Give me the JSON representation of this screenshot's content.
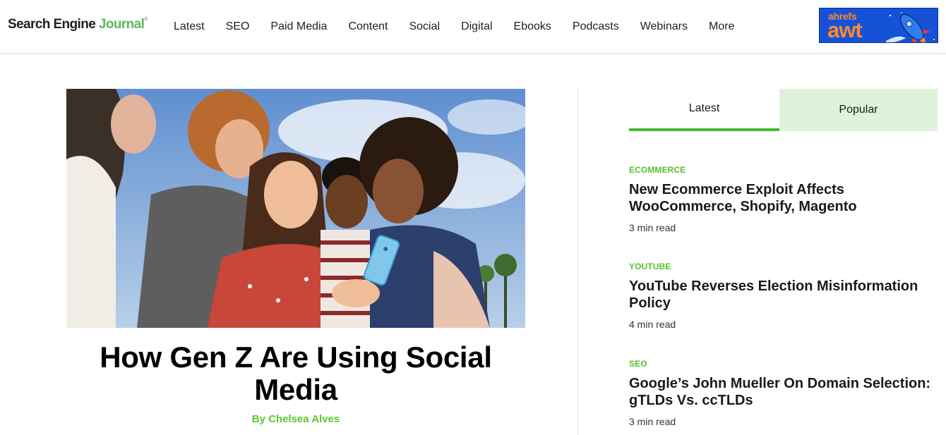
{
  "logo": {
    "text_main": "Search Engine ",
    "text_accent": "Journal",
    "tm": "®"
  },
  "nav": [
    {
      "label": "Latest"
    },
    {
      "label": "SEO"
    },
    {
      "label": "Paid Media"
    },
    {
      "label": "Content"
    },
    {
      "label": "Social"
    },
    {
      "label": "Digital"
    },
    {
      "label": "Ebooks"
    },
    {
      "label": "Podcasts"
    },
    {
      "label": "Webinars"
    },
    {
      "label": "More"
    }
  ],
  "ad": {
    "brand": "ahrefs",
    "product": "awt"
  },
  "hero": {
    "image_icon": "group-photo",
    "title": "How Gen Z Are Using Social Media",
    "byline": "By Chelsea Alves"
  },
  "sidebar": {
    "tabs": [
      {
        "label": "Latest"
      },
      {
        "label": "Popular"
      }
    ],
    "articles": [
      {
        "category": "ECOMMERCE",
        "title": "New Ecommerce Exploit Affects WooCommerce, Shopify, Magento",
        "read_time": "3 min read"
      },
      {
        "category": "YOUTUBE",
        "title": "YouTube Reverses Election Misinformation Policy",
        "read_time": "4 min read"
      },
      {
        "category": "SEO",
        "title": "Google’s John Mueller On Domain Selection: gTLDs Vs. ccTLDs",
        "read_time": "3 min read"
      }
    ]
  },
  "colors": {
    "accent_green": "#55c12e",
    "tab_active_bg": "#dff3da",
    "ad_blue": "#1652d8",
    "ad_orange": "#ff8a2b"
  }
}
